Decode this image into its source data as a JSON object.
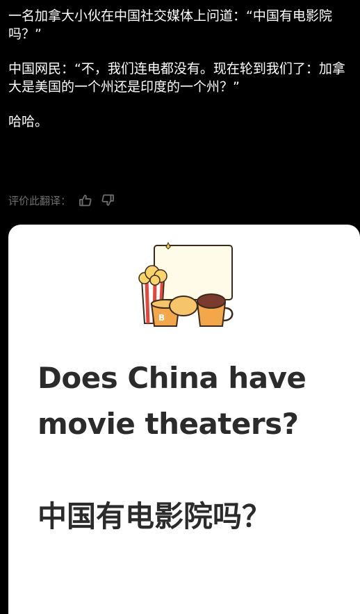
{
  "post": {
    "paragraph_1": "一名加拿大小伙在中国社交媒体上问道：“中国有电影院吗？”",
    "paragraph_2": "中国网民：“不，我们连电都没有。现在轮到我们了：加拿大是美国的一个州还是印度的一个州？”",
    "paragraph_3": "哈哈。"
  },
  "rating": {
    "label": "评价此翻译：",
    "thumbs_up_icon": "thumbs-up-icon",
    "thumbs_down_icon": "thumbs-down-icon"
  },
  "card": {
    "illustration": "popcorn-and-drinks-illustration",
    "title_en": "Does China have movie theaters?",
    "title_zh": "中国有电影院吗？"
  },
  "colors": {
    "background": "#000000",
    "text": "#ffffff",
    "muted": "#6f6f6f",
    "card": "#ffffff",
    "card_text": "#2b2b2b",
    "accent_orange": "#f3a64a"
  }
}
